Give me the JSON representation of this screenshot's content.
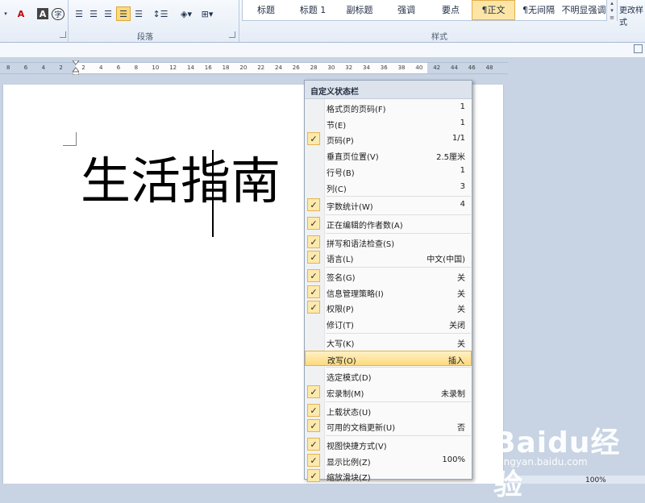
{
  "ribbon": {
    "font_group": {
      "buttons": [
        "A",
        "A",
        "字"
      ]
    },
    "paragraph_group": {
      "label": "段落"
    },
    "styles_group": {
      "label": "样式",
      "items": [
        {
          "label": "标题",
          "selected": false
        },
        {
          "label": "标题 1",
          "selected": false
        },
        {
          "label": "副标题",
          "selected": false
        },
        {
          "label": "强调",
          "selected": false
        },
        {
          "label": "要点",
          "selected": false
        },
        {
          "label": "¶正文",
          "selected": true
        },
        {
          "label": "¶无间隔",
          "selected": false
        },
        {
          "label": "不明显强调",
          "selected": false
        }
      ],
      "change_styles": "更改样式"
    }
  },
  "ruler": {
    "ticks": [
      "8",
      "6",
      "4",
      "2",
      "2",
      "4",
      "6",
      "8",
      "10",
      "12",
      "14",
      "16",
      "18",
      "20",
      "22",
      "24",
      "26",
      "28",
      "30",
      "32",
      "34",
      "36",
      "38",
      "40",
      "42",
      "44",
      "46",
      "48"
    ]
  },
  "document": {
    "text_before_caret": "生活",
    "text_after_caret": "指南"
  },
  "context_menu": {
    "title": "自定义状态栏",
    "items": [
      {
        "label": "格式页的页码(F)",
        "value": "1",
        "checked": false
      },
      {
        "label": "节(E)",
        "value": "1",
        "checked": false
      },
      {
        "label": "页码(P)",
        "value": "1/1",
        "checked": true
      },
      {
        "label": "垂直页位置(V)",
        "value": "2.5厘米",
        "checked": false
      },
      {
        "label": "行号(B)",
        "value": "1",
        "checked": false
      },
      {
        "label": "列(C)",
        "value": "3",
        "checked": false
      },
      {
        "label": "字数统计(W)",
        "value": "4",
        "checked": true,
        "sep_before": true
      },
      {
        "label": "正在编辑的作者数(A)",
        "value": "",
        "checked": true,
        "sep_before": true
      },
      {
        "label": "拼写和语法检查(S)",
        "value": "",
        "checked": true,
        "sep_before": true
      },
      {
        "label": "语言(L)",
        "value": "中文(中国)",
        "checked": true
      },
      {
        "label": "签名(G)",
        "value": "关",
        "checked": true,
        "sep_before": true
      },
      {
        "label": "信息管理策略(I)",
        "value": "关",
        "checked": true
      },
      {
        "label": "权限(P)",
        "value": "关",
        "checked": true
      },
      {
        "label": "修订(T)",
        "value": "关闭",
        "checked": false
      },
      {
        "label": "大写(K)",
        "value": "关",
        "checked": false,
        "sep_before": true
      },
      {
        "label": "改写(O)",
        "value": "插入",
        "checked": false,
        "highlighted": true
      },
      {
        "label": "选定模式(D)",
        "value": "",
        "checked": false,
        "sep_before": true
      },
      {
        "label": "宏录制(M)",
        "value": "未录制",
        "checked": true
      },
      {
        "label": "上载状态(U)",
        "value": "",
        "checked": true,
        "sep_before": true
      },
      {
        "label": "可用的文档更新(U)",
        "value": "否",
        "checked": true
      },
      {
        "label": "视图快捷方式(V)",
        "value": "",
        "checked": true,
        "sep_before": true
      },
      {
        "label": "显示比例(Z)",
        "value": "100%",
        "checked": true
      },
      {
        "label": "缩放滑块(Z)",
        "value": "",
        "checked": true
      }
    ]
  },
  "status": {
    "zoom": "100%"
  },
  "watermark": {
    "logo": "Baidu经验",
    "url": "jingyan.baidu.com"
  },
  "colors": {
    "ribbon_bg": "#e5ecf6",
    "menu_highlight": "#fcd97d",
    "check_bg": "#fde9ac",
    "workspace": "#c8d3e3"
  }
}
